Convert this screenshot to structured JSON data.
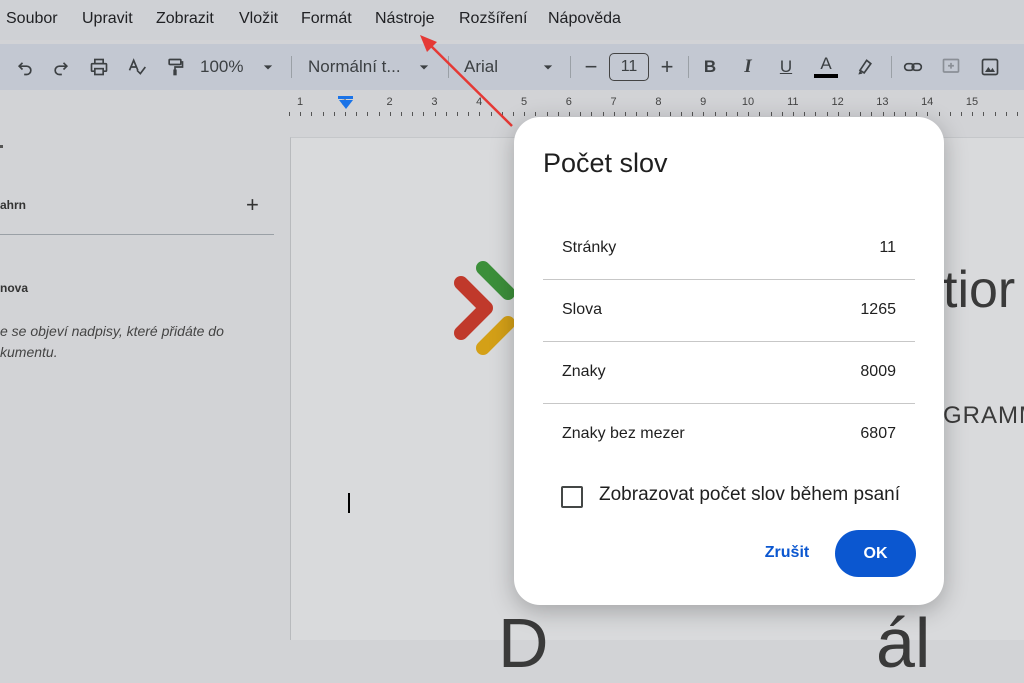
{
  "menu": {
    "items": [
      "Soubor",
      "Upravit",
      "Zobrazit",
      "Vložit",
      "Formát",
      "Nástroje",
      "Rozšíření",
      "Nápověda"
    ]
  },
  "toolbar": {
    "zoom": "100%",
    "style": "Normální t...",
    "font": "Arial",
    "font_size": "11",
    "minus": "−",
    "plus": "+",
    "bold": "B",
    "italic": "I",
    "underline": "U",
    "text_color": "A"
  },
  "ruler": {
    "numbers": [
      "1",
      "1",
      "2",
      "3",
      "4",
      "5",
      "6",
      "7",
      "8",
      "9",
      "10",
      "11",
      "12",
      "13",
      "14",
      "15"
    ]
  },
  "sidebar": {
    "summary_label": "ahrn",
    "add_symbol": "+",
    "outline_label": "nova",
    "outline_hint": "e se objeví nadpisy, které přidáte do kumentu."
  },
  "document": {
    "header_text_partial": "tior",
    "subtext_partial": "GRAMM",
    "bottom_text_partial": "D",
    "bottom_text_partial2": "ál"
  },
  "dialog": {
    "title": "Počet slov",
    "rows": [
      {
        "label": "Stránky",
        "value": "11"
      },
      {
        "label": "Slova",
        "value": "1265"
      },
      {
        "label": "Znaky",
        "value": "8009"
      },
      {
        "label": "Znaky bez mezer",
        "value": "6807"
      }
    ],
    "checkbox_label": "Zobrazovat počet slov během psaní",
    "checkbox_checked": false,
    "cancel_label": "Zrušit",
    "ok_label": "OK"
  },
  "colors": {
    "accent": "#0b57d0",
    "annotation_arrow": "#e53935"
  }
}
